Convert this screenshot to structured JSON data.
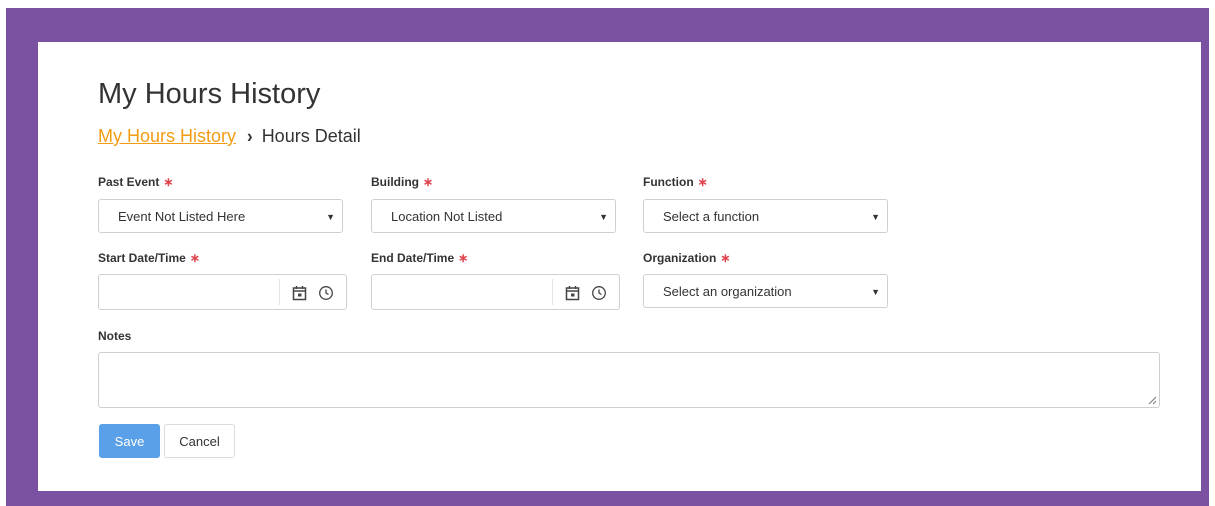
{
  "page": {
    "title": "My Hours History"
  },
  "breadcrumb": {
    "link": "My Hours History",
    "separator": "›",
    "current": "Hours Detail"
  },
  "form": {
    "required_marker": "∗",
    "past_event": {
      "label": "Past Event",
      "value": "Event Not Listed Here"
    },
    "building": {
      "label": "Building",
      "value": "Location Not Listed"
    },
    "function": {
      "label": "Function",
      "value": "Select a function"
    },
    "start": {
      "label": "Start Date/Time",
      "value": ""
    },
    "end": {
      "label": "End Date/Time",
      "value": ""
    },
    "organization": {
      "label": "Organization",
      "value": "Select an organization"
    },
    "notes": {
      "label": "Notes",
      "value": ""
    }
  },
  "buttons": {
    "save": "Save",
    "cancel": "Cancel"
  },
  "colors": {
    "frame": "#7b52a1",
    "link": "#f39c12",
    "required": "#e0444e",
    "primary": "#5aa0e8"
  },
  "icons": [
    "calendar-icon",
    "clock-icon",
    "caret-down-icon",
    "chevron-right-icon",
    "resize-grip-icon"
  ]
}
